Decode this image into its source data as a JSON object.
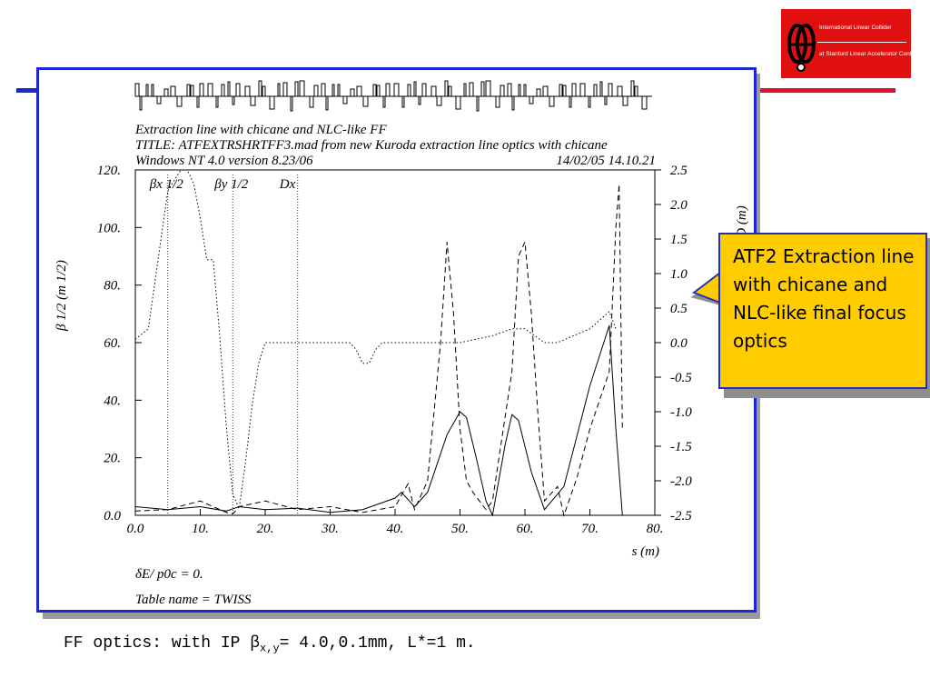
{
  "logo": {
    "line1": "International Linear Collider",
    "line2": "at Stanford Linear Accelerator Center"
  },
  "plot": {
    "header": [
      "Extraction line with chicane and NLC-like FF",
      "TITLE: ATFEXTRSHRTFF3.mad from new Kuroda extraction line optics with chicane",
      "Windows NT 4.0 version 8.23/06"
    ],
    "date": "14/02/05  14.10.21",
    "footer": [
      "δE/ p0c  =  0.",
      "Table name = TWISS"
    ]
  },
  "callout": {
    "text": "ATF2 Extraction line with chicane and NLC-like final focus optics"
  },
  "caption": {
    "prefix": "FF optics: with IP ",
    "beta": "β",
    "sub": "x,y",
    "suffix": "= 4.0,0.1mm, L*=1 m."
  },
  "colors": {
    "frame": "#1a27d4",
    "deco_line": "#e0102a",
    "callout_fill": "#ffcc00",
    "logo": "#e01010"
  },
  "chart_data": {
    "type": "line",
    "xlabel": "s (m)",
    "ylabel": "β 1/2 (m 1/2)",
    "y2label": "D (m)",
    "xlim": [
      0,
      80
    ],
    "ylim": [
      0,
      120
    ],
    "y2lim": [
      -2.5,
      2.5
    ],
    "xticks": [
      "0.0",
      "10.",
      "20.",
      "30.",
      "40.",
      "50.",
      "60.",
      "70.",
      "80."
    ],
    "yticks": [
      "0.0",
      "20.",
      "40.",
      "60.",
      "80.",
      "100.",
      "120."
    ],
    "y2ticks": [
      "-2.5",
      "-2.0",
      "-1.5",
      "-1.0",
      "-0.5",
      "0.0",
      "0.5",
      "1.0",
      "1.5",
      "2.0",
      "2.5"
    ],
    "legend": [
      "βx 1/2",
      "βy 1/2",
      "Dx"
    ],
    "series": [
      {
        "name": "βx 1/2",
        "style": "solid",
        "axis": "left",
        "x": [
          0,
          5,
          10,
          14,
          16,
          20,
          25,
          30,
          35,
          40,
          41,
          43,
          45,
          48,
          50,
          51,
          52.5,
          54,
          55,
          57,
          58,
          59,
          61,
          63,
          66,
          70,
          73,
          74,
          75
        ],
        "y": [
          3,
          2,
          3,
          1.5,
          3,
          2,
          2.5,
          1,
          2,
          6,
          8,
          3,
          8,
          28,
          36,
          34,
          20,
          5,
          0,
          25,
          35,
          33,
          15,
          2,
          10,
          45,
          66,
          30,
          0
        ]
      },
      {
        "name": "βy 1/2",
        "style": "dashed",
        "axis": "left",
        "x": [
          0,
          5,
          10,
          14,
          15,
          16,
          20,
          25,
          30,
          35,
          40,
          42,
          43,
          45,
          47,
          48,
          49,
          50,
          51,
          52,
          53,
          54,
          55,
          56,
          58,
          59,
          60,
          61,
          62,
          63,
          65,
          66,
          68,
          70,
          73,
          74,
          74.5,
          75
        ],
        "y": [
          1.5,
          2,
          5,
          1,
          0.5,
          3,
          5,
          2,
          3,
          1,
          3,
          11,
          2,
          12,
          60,
          95,
          70,
          30,
          12,
          8,
          5,
          2,
          5,
          20,
          50,
          90,
          95,
          70,
          35,
          5,
          10,
          0,
          13,
          30,
          50,
          100,
          115,
          30
        ]
      },
      {
        "name": "Dx",
        "style": "dotted",
        "axis": "right",
        "x": [
          0,
          2,
          5,
          7,
          8,
          9,
          10,
          11,
          12,
          13,
          14,
          15,
          16,
          17,
          18,
          19,
          20,
          25,
          30,
          33,
          34,
          35,
          36,
          37,
          38,
          40,
          50,
          55,
          58,
          60,
          63,
          65,
          70,
          73,
          74
        ],
        "y": [
          0.05,
          0.2,
          2.2,
          2.5,
          2.5,
          2.3,
          1.8,
          1.2,
          1.2,
          0.1,
          -1.2,
          -2.2,
          -2.4,
          -1.7,
          -0.9,
          -0.3,
          0,
          0,
          0,
          0,
          -0.1,
          -0.3,
          -0.3,
          -0.1,
          0,
          0,
          0,
          0.1,
          0.2,
          0.2,
          0,
          0,
          0.2,
          0.45,
          0.2
        ]
      }
    ],
    "annotations": [
      {
        "label": "βx 1/2",
        "x": 5
      },
      {
        "label": "βy 1/2",
        "x": 15
      },
      {
        "label": "Dx",
        "x": 25
      }
    ]
  }
}
